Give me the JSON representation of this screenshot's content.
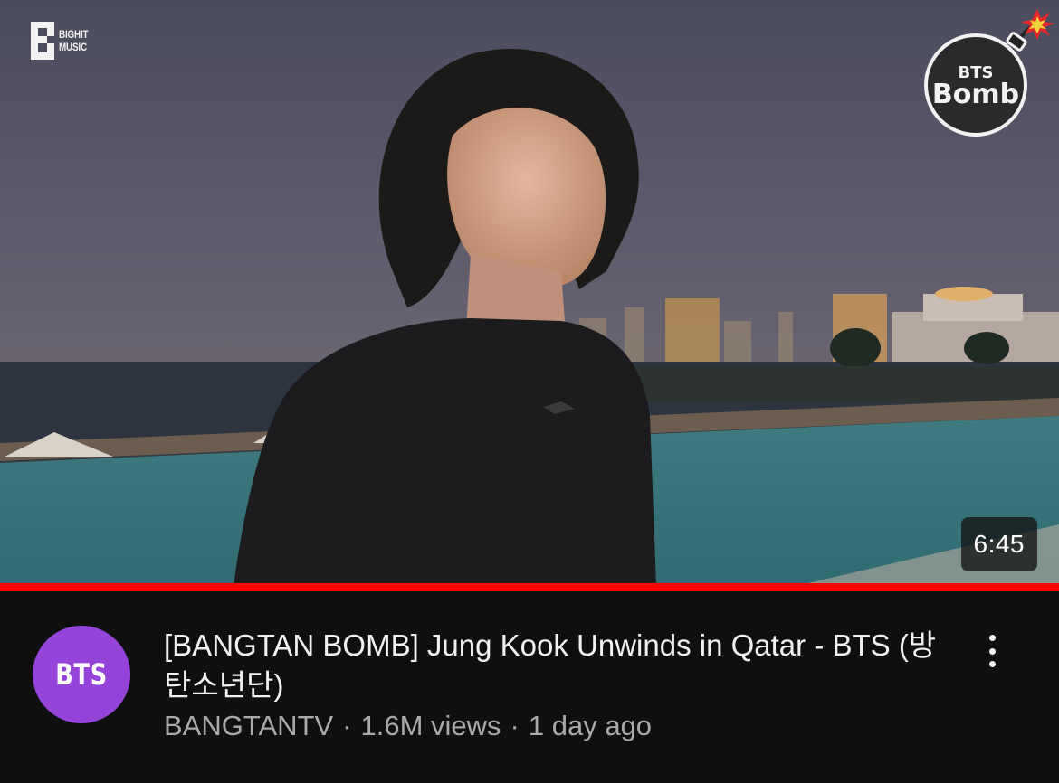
{
  "video": {
    "duration": "6:45",
    "progress_fraction": 1.0,
    "label_logo_text": "BIGHIT\nMUSIC",
    "bomb_logo_text": [
      "BTS",
      "Bomb"
    ],
    "title": "[BANGTAN BOMB] Jung Kook Unwinds in Qatar - BTS (방탄소년단)",
    "channel": {
      "avatar_text": "BTS",
      "avatar_color": "#9444d8",
      "name": "BANGTANTV"
    },
    "views": "1.6M views",
    "age": "1 day ago",
    "separator": "·"
  },
  "icons": {
    "more": "more-vertical-icon"
  },
  "colors": {
    "progress": "#ff0000",
    "background": "#0f0f0f",
    "secondary_text": "#aaaaaa"
  }
}
